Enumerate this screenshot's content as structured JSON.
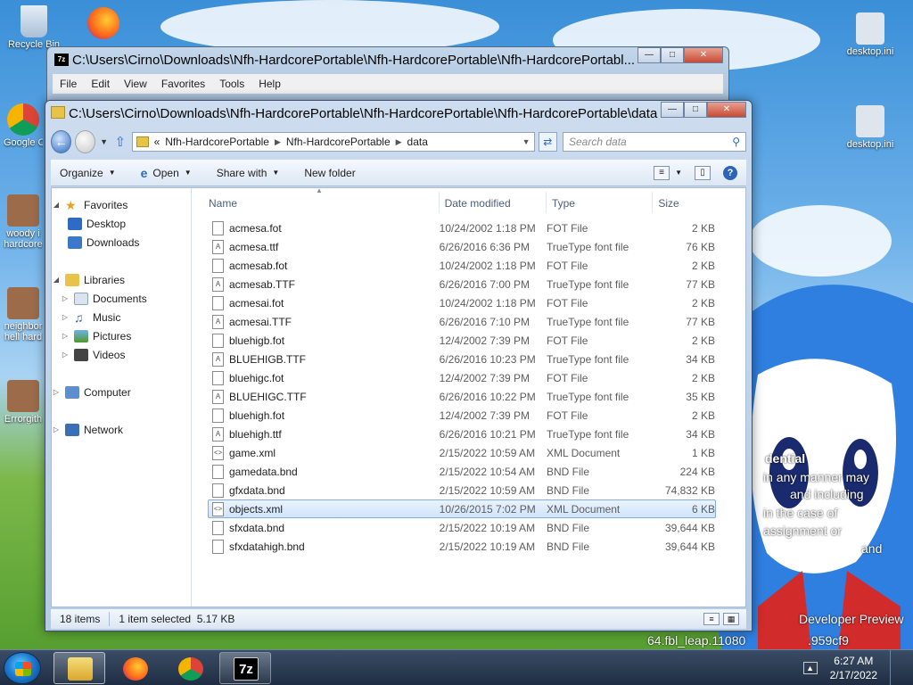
{
  "desktop": {
    "icons": [
      {
        "label": "Recycle Bin"
      },
      {
        "label": "Google Chrome"
      },
      {
        "label": "woody i hardcore"
      },
      {
        "label": "neighbor hell hard"
      },
      {
        "label": "Errorgith"
      },
      {
        "label": "desktop.ini"
      },
      {
        "label": "desktop.ini"
      }
    ],
    "watermark_lines": [
      "dential",
      "in any manner may",
      "and including",
      "in the case of",
      "assignment or",
      "and",
      "Developer Preview",
      "64.fbl_leap.11080",
      ".959cf9"
    ]
  },
  "back_window": {
    "title": "C:\\Users\\Cirno\\Downloads\\Nfh-HardcorePortable\\Nfh-HardcorePortable\\Nfh-HardcorePortabl...",
    "menu": [
      "File",
      "Edit",
      "View",
      "Favorites",
      "Tools",
      "Help"
    ]
  },
  "explorer": {
    "title": "C:\\Users\\Cirno\\Downloads\\Nfh-HardcorePortable\\Nfh-HardcorePortable\\Nfh-HardcorePortable\\data",
    "address": {
      "overflow": "«",
      "crumbs": [
        "Nfh-HardcorePortable",
        "Nfh-HardcorePortable",
        "data"
      ]
    },
    "search_placeholder": "Search data",
    "toolbar": {
      "organize": "Organize",
      "open": "Open",
      "share_with": "Share with",
      "new_folder": "New folder"
    },
    "nav": {
      "favorites": "Favorites",
      "desktop": "Desktop",
      "downloads": "Downloads",
      "libraries": "Libraries",
      "documents": "Documents",
      "music": "Music",
      "pictures": "Pictures",
      "videos": "Videos",
      "computer": "Computer",
      "network": "Network"
    },
    "columns": {
      "name": "Name",
      "date": "Date modified",
      "type": "Type",
      "size": "Size"
    },
    "files": [
      {
        "name": "acmesa.fot",
        "date": "10/24/2002 1:18 PM",
        "type": "FOT File",
        "size": "2 KB",
        "icon": "doc"
      },
      {
        "name": "acmesa.ttf",
        "date": "6/26/2016 6:36 PM",
        "type": "TrueType font file",
        "size": "76 KB",
        "icon": "font"
      },
      {
        "name": "acmesab.fot",
        "date": "10/24/2002 1:18 PM",
        "type": "FOT File",
        "size": "2 KB",
        "icon": "doc"
      },
      {
        "name": "acmesab.TTF",
        "date": "6/26/2016 7:00 PM",
        "type": "TrueType font file",
        "size": "77 KB",
        "icon": "font"
      },
      {
        "name": "acmesai.fot",
        "date": "10/24/2002 1:18 PM",
        "type": "FOT File",
        "size": "2 KB",
        "icon": "doc"
      },
      {
        "name": "acmesai.TTF",
        "date": "6/26/2016 7:10 PM",
        "type": "TrueType font file",
        "size": "77 KB",
        "icon": "font"
      },
      {
        "name": "bluehigb.fot",
        "date": "12/4/2002 7:39 PM",
        "type": "FOT File",
        "size": "2 KB",
        "icon": "doc"
      },
      {
        "name": "BLUEHIGB.TTF",
        "date": "6/26/2016 10:23 PM",
        "type": "TrueType font file",
        "size": "34 KB",
        "icon": "font"
      },
      {
        "name": "bluehigc.fot",
        "date": "12/4/2002 7:39 PM",
        "type": "FOT File",
        "size": "2 KB",
        "icon": "doc"
      },
      {
        "name": "BLUEHIGC.TTF",
        "date": "6/26/2016 10:22 PM",
        "type": "TrueType font file",
        "size": "35 KB",
        "icon": "font"
      },
      {
        "name": "bluehigh.fot",
        "date": "12/4/2002 7:39 PM",
        "type": "FOT File",
        "size": "2 KB",
        "icon": "doc"
      },
      {
        "name": "bluehigh.ttf",
        "date": "6/26/2016 10:21 PM",
        "type": "TrueType font file",
        "size": "34 KB",
        "icon": "font"
      },
      {
        "name": "game.xml",
        "date": "2/15/2022 10:59 AM",
        "type": "XML Document",
        "size": "1 KB",
        "icon": "xml"
      },
      {
        "name": "gamedata.bnd",
        "date": "2/15/2022 10:54 AM",
        "type": "BND File",
        "size": "224 KB",
        "icon": "doc"
      },
      {
        "name": "gfxdata.bnd",
        "date": "2/15/2022 10:59 AM",
        "type": "BND File",
        "size": "74,832 KB",
        "icon": "doc"
      },
      {
        "name": "objects.xml",
        "date": "10/26/2015 7:02 PM",
        "type": "XML Document",
        "size": "6 KB",
        "icon": "xml",
        "selected": true
      },
      {
        "name": "sfxdata.bnd",
        "date": "2/15/2022 10:19 AM",
        "type": "BND File",
        "size": "39,644 KB",
        "icon": "doc"
      },
      {
        "name": "sfxdatahigh.bnd",
        "date": "2/15/2022 10:19 AM",
        "type": "BND File",
        "size": "39,644 KB",
        "icon": "doc"
      }
    ],
    "status": {
      "count": "18 items",
      "selection": "1 item selected  5.17 KB"
    }
  },
  "taskbar": {
    "time": "6:27 AM",
    "date": "2/17/2022",
    "seven_zip_label": "7z"
  }
}
